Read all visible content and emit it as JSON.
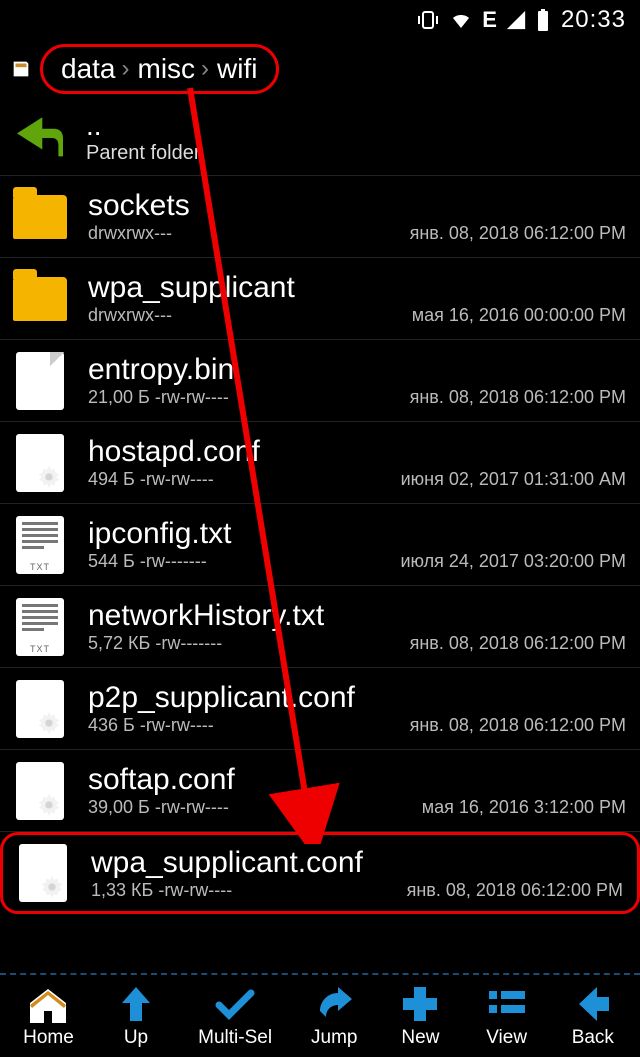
{
  "status": {
    "time": "20:33"
  },
  "breadcrumb": [
    "data",
    "misc",
    "wifi"
  ],
  "parent": {
    "dots": "..",
    "label": "Parent folder"
  },
  "items": [
    {
      "icon": "folder",
      "name": "sockets",
      "meta": "drwxrwx---",
      "date": "янв. 08, 2018 06:12:00 PM"
    },
    {
      "icon": "folder",
      "name": "wpa_supplicant",
      "meta": "drwxrwx---",
      "date": "мая 16, 2016 00:00:00 PM"
    },
    {
      "icon": "file",
      "name": "entropy.bin",
      "meta": "21,00 Б -rw-rw----",
      "date": "янв. 08, 2018 06:12:00 PM"
    },
    {
      "icon": "conf",
      "name": "hostapd.conf",
      "meta": "494 Б -rw-rw----",
      "date": "июня 02, 2017 01:31:00 AM"
    },
    {
      "icon": "txt",
      "name": "ipconfig.txt",
      "meta": "544 Б -rw-------",
      "date": "июля 24, 2017 03:20:00 PM"
    },
    {
      "icon": "txt",
      "name": "networkHistory.txt",
      "meta": "5,72 КБ -rw-------",
      "date": "янв. 08, 2018 06:12:00 PM"
    },
    {
      "icon": "conf",
      "name": "p2p_supplicant.conf",
      "meta": "436 Б -rw-rw----",
      "date": "янв. 08, 2018 06:12:00 PM"
    },
    {
      "icon": "conf",
      "name": "softap.conf",
      "meta": "39,00 Б -rw-rw----",
      "date": "мая 16, 2016 3:12:00 PM"
    },
    {
      "icon": "conf",
      "name": "wpa_supplicant.conf",
      "meta": "1,33 КБ -rw-rw----",
      "date": "янв. 08, 2018 06:12:00 PM",
      "highlight": true
    }
  ],
  "nav": {
    "home": "Home",
    "up": "Up",
    "multisel": "Multi-Sel",
    "jump": "Jump",
    "new": "New",
    "view": "View",
    "back": "Back"
  }
}
